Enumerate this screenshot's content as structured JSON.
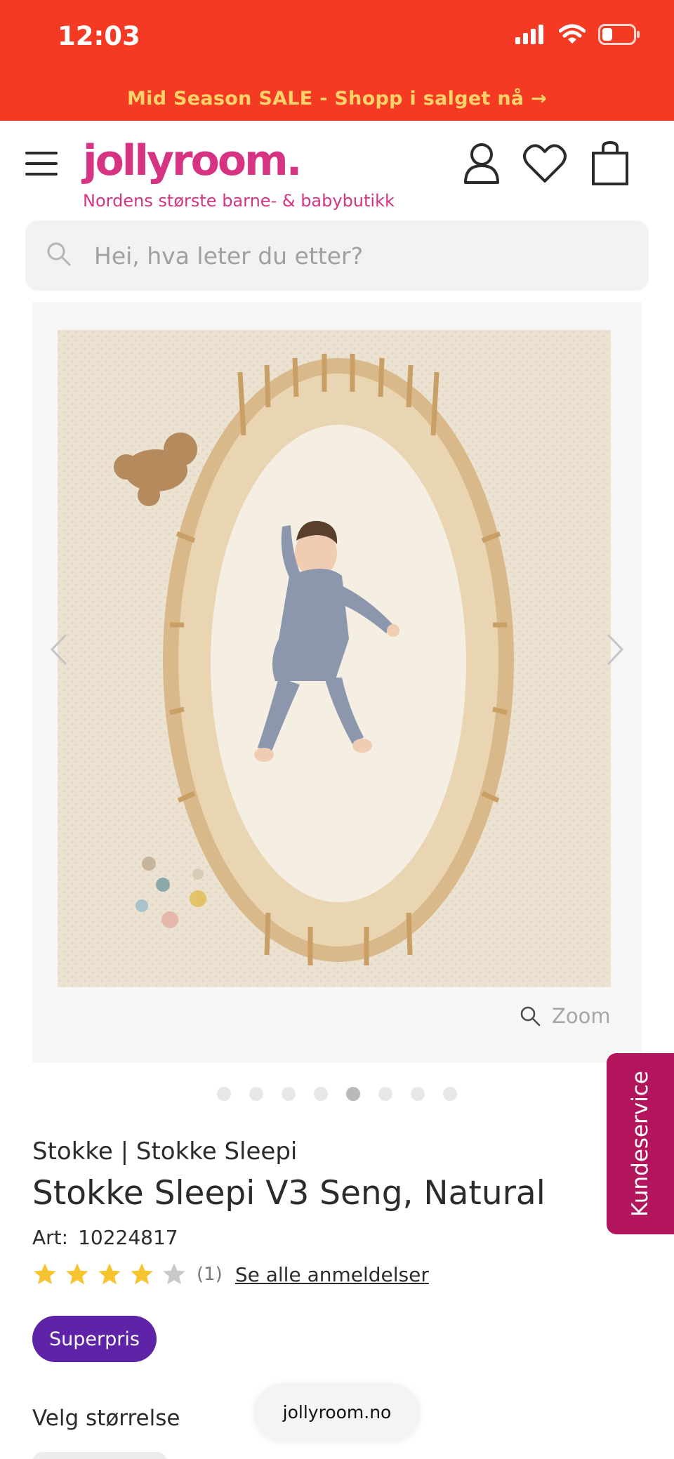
{
  "status_bar": {
    "time": "12:03",
    "icons": [
      "signal-icon",
      "wifi-icon",
      "battery-icon"
    ]
  },
  "promo": {
    "text": "Mid Season SALE - Shopp i salget nå →",
    "background": "#f43a22",
    "text_color": "#ffd36a"
  },
  "header": {
    "logo": "jollyroom.",
    "tagline": "Nordens største barne- & babybutikk",
    "brand_color": "#d63482",
    "icons": [
      "menu-icon",
      "account-icon",
      "wishlist-icon",
      "cart-icon"
    ]
  },
  "search": {
    "placeholder": "Hei, hva leter du etter?"
  },
  "gallery": {
    "zoom_label": "Zoom",
    "image_count": 8,
    "active_index": 4
  },
  "product": {
    "brand": "Stokke | Stokke Sleepi",
    "title": "Stokke Sleepi V3 Seng, Natural",
    "art_label": "Art:",
    "art_number": "10224817",
    "rating": 4,
    "rating_max": 5,
    "review_count": "(1)",
    "reviews_link": "Se alle anmeldelser",
    "badge": "Superpris",
    "badge_color": "#5e23a6",
    "size_label": "Velg størrelse"
  },
  "customer_service": {
    "label": "Kundeservice",
    "color": "#b3155d"
  },
  "browser": {
    "url": "jollyroom.no"
  }
}
